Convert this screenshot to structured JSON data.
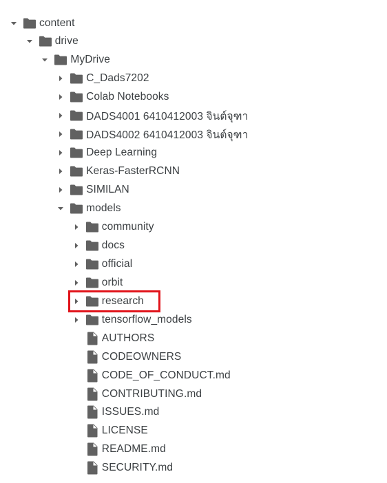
{
  "file_tree": [
    {
      "label": "content",
      "type": "folder",
      "state": "expanded",
      "depth": 0,
      "icon": "folder-icon"
    },
    {
      "label": "drive",
      "type": "folder",
      "state": "expanded",
      "depth": 1,
      "icon": "folder-icon"
    },
    {
      "label": "MyDrive",
      "type": "folder",
      "state": "expanded",
      "depth": 2,
      "icon": "folder-icon"
    },
    {
      "label": "C_Dads7202",
      "type": "folder",
      "state": "collapsed",
      "depth": 3,
      "icon": "folder-icon"
    },
    {
      "label": "Colab Notebooks",
      "type": "folder",
      "state": "collapsed",
      "depth": 3,
      "icon": "folder-icon"
    },
    {
      "label": "DADS4001 6410412003 จินต์จุฑา",
      "type": "folder",
      "state": "collapsed",
      "depth": 3,
      "icon": "folder-icon"
    },
    {
      "label": "DADS4002 6410412003 จินต์จุฑา",
      "type": "folder",
      "state": "collapsed",
      "depth": 3,
      "icon": "folder-icon"
    },
    {
      "label": "Deep Learning",
      "type": "folder",
      "state": "collapsed",
      "depth": 3,
      "icon": "folder-icon"
    },
    {
      "label": "Keras-FasterRCNN",
      "type": "folder",
      "state": "collapsed",
      "depth": 3,
      "icon": "folder-icon"
    },
    {
      "label": "SIMILAN",
      "type": "folder",
      "state": "collapsed",
      "depth": 3,
      "icon": "folder-icon"
    },
    {
      "label": "models",
      "type": "folder",
      "state": "expanded",
      "depth": 3,
      "icon": "folder-icon"
    },
    {
      "label": "community",
      "type": "folder",
      "state": "collapsed",
      "depth": 4,
      "icon": "folder-icon"
    },
    {
      "label": "docs",
      "type": "folder",
      "state": "collapsed",
      "depth": 4,
      "icon": "folder-icon"
    },
    {
      "label": "official",
      "type": "folder",
      "state": "collapsed",
      "depth": 4,
      "icon": "folder-icon"
    },
    {
      "label": "orbit",
      "type": "folder",
      "state": "collapsed",
      "depth": 4,
      "icon": "folder-icon"
    },
    {
      "label": "research",
      "type": "folder",
      "state": "collapsed",
      "depth": 4,
      "icon": "folder-icon",
      "highlighted": true
    },
    {
      "label": "tensorflow_models",
      "type": "folder",
      "state": "collapsed",
      "depth": 4,
      "icon": "folder-icon"
    },
    {
      "label": "AUTHORS",
      "type": "file",
      "depth": 4,
      "icon": "file-icon"
    },
    {
      "label": "CODEOWNERS",
      "type": "file",
      "depth": 4,
      "icon": "file-icon"
    },
    {
      "label": "CODE_OF_CONDUCT.md",
      "type": "file",
      "depth": 4,
      "icon": "file-icon"
    },
    {
      "label": "CONTRIBUTING.md",
      "type": "file",
      "depth": 4,
      "icon": "file-icon"
    },
    {
      "label": "ISSUES.md",
      "type": "file",
      "depth": 4,
      "icon": "file-icon"
    },
    {
      "label": "LICENSE",
      "type": "file",
      "depth": 4,
      "icon": "file-icon"
    },
    {
      "label": "README.md",
      "type": "file",
      "depth": 4,
      "icon": "file-icon"
    },
    {
      "label": "SECURITY.md",
      "type": "file",
      "depth": 4,
      "icon": "file-icon"
    }
  ],
  "colors": {
    "icon": "#616161",
    "text": "#3c4043",
    "highlight_border": "#e1141b"
  }
}
